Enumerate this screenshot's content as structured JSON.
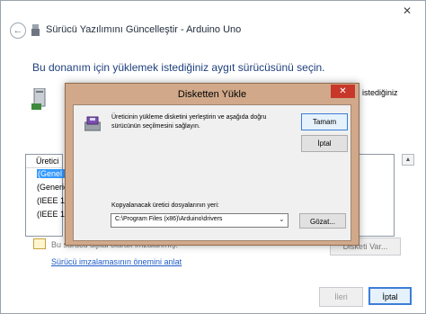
{
  "window": {
    "title": "Sürücü Yazılımını Güncelleştir - Arduino Uno",
    "close_glyph": "✕",
    "back_glyph": "←"
  },
  "main": {
    "heading": "Bu donanım için yüklemek istediğiniz aygıt sürücüsünü seçin.",
    "tail_text": "istediğiniz",
    "list_header": "Üretici",
    "list_items": [
      "(Genel U",
      "(Generic",
      "(IEEE 16",
      "(IEEE 16"
    ],
    "scroll_glyph": "▲",
    "signed_text": "Bu sürücü dijital olarak imzalanmış.",
    "disk_button": "Disketi Var...",
    "why_link": "Sürücü imzalamasının önemini anlat",
    "next_button": "İleri",
    "cancel_button": "İptal"
  },
  "dialog": {
    "title": "Disketten Yükle",
    "close_glyph": "✕",
    "message_line1": "Üreticinin yükleme disketini yerleştirin ve aşağıda doğru",
    "message_line2": "sürücünün seçilmesini sağlayın.",
    "ok_button": "Tamam",
    "cancel_button": "İptal",
    "path_label": "Kopyalanacak üretici dosyalarının yeri:",
    "path_value": "C:\\Program Files (x86)\\Arduino\\drivers",
    "path_chevron": "⌄",
    "browse_button": "Gözat..."
  },
  "colors": {
    "dialog_frame": "#d1a98a",
    "close_red": "#c7382b",
    "heading_blue": "#1e3f7c",
    "selection_blue": "#3399ff",
    "link_blue": "#1d5cc7"
  },
  "icons": [
    "back-arrow-icon",
    "usb-device-icon",
    "device-tower-icon",
    "disk-drive-icon",
    "signed-shield-icon"
  ]
}
